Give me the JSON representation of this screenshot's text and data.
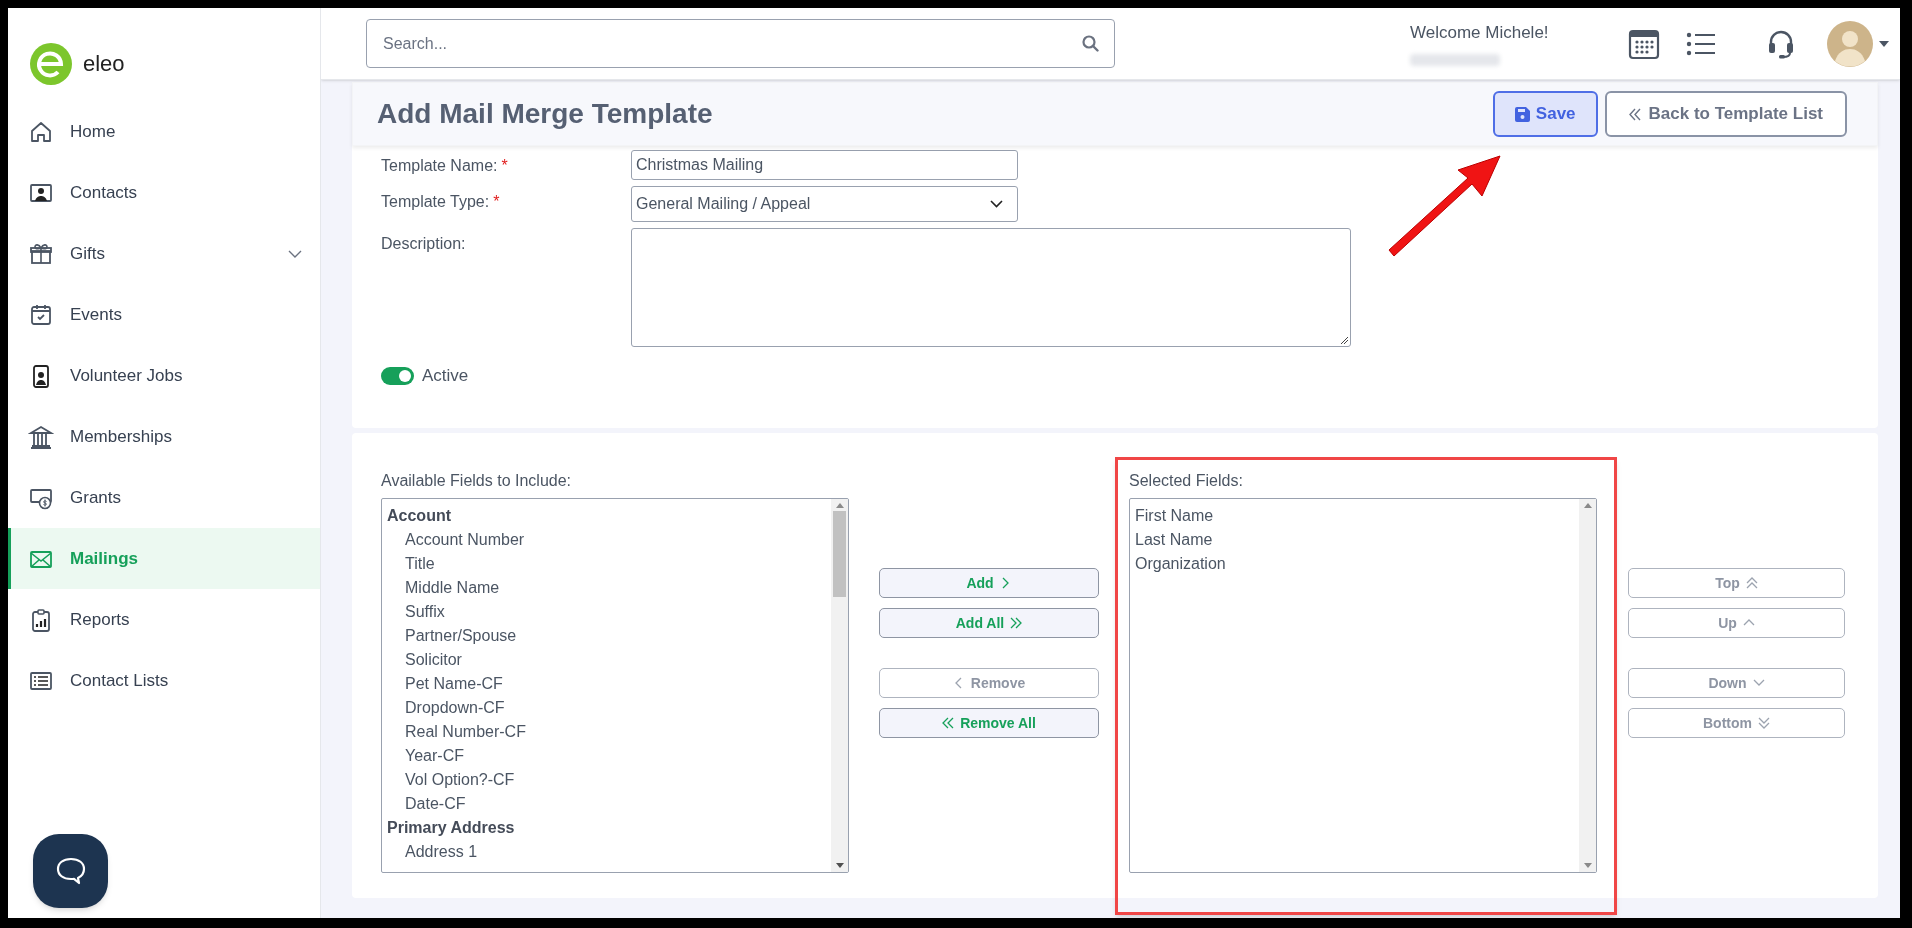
{
  "brand": {
    "name": "eleo"
  },
  "sidebar": {
    "items": [
      {
        "label": "Home",
        "selected": false,
        "kind": "link"
      },
      {
        "label": "Contacts",
        "selected": false,
        "kind": "link"
      },
      {
        "label": "Gifts",
        "selected": false,
        "kind": "menu"
      },
      {
        "label": "Events",
        "selected": false,
        "kind": "link"
      },
      {
        "label": "Volunteer Jobs",
        "selected": false,
        "kind": "link"
      },
      {
        "label": "Memberships",
        "selected": false,
        "kind": "link"
      },
      {
        "label": "Grants",
        "selected": false,
        "kind": "link"
      },
      {
        "label": "Mailings",
        "selected": true,
        "kind": "link"
      },
      {
        "label": "Reports",
        "selected": false,
        "kind": "link"
      },
      {
        "label": "Contact Lists",
        "selected": false,
        "kind": "link"
      }
    ]
  },
  "header": {
    "search": {
      "placeholder": "Search..."
    },
    "welcome": "Welcome Michele!"
  },
  "page": {
    "title": "Add Mail Merge Template",
    "buttons": [
      {
        "label": "Save",
        "kind": "primary"
      },
      {
        "label": "Back to Template List",
        "kind": "back"
      }
    ]
  },
  "form": {
    "fields": [
      {
        "label": "Template Name:",
        "marker": "*",
        "kind": "text",
        "value": "Christmas Mailing"
      },
      {
        "label": "Template Type:",
        "marker": "*",
        "kind": "select",
        "value": "General Mailing / Appeal"
      },
      {
        "label": "Description:",
        "kind": "textarea"
      }
    ],
    "active": {
      "label": "Active",
      "on": true
    }
  },
  "fields_picker": {
    "available": {
      "label": "Available Fields to Include:",
      "items": [
        {
          "text": "Account",
          "kind": "group"
        },
        {
          "text": "Account Number",
          "kind": "field"
        },
        {
          "text": "Title",
          "kind": "field"
        },
        {
          "text": "Middle Name",
          "kind": "field"
        },
        {
          "text": "Suffix",
          "kind": "field"
        },
        {
          "text": "Partner/Spouse",
          "kind": "field"
        },
        {
          "text": "Solicitor",
          "kind": "field"
        },
        {
          "text": "Pet Name-CF",
          "kind": "field"
        },
        {
          "text": "Dropdown-CF",
          "kind": "field"
        },
        {
          "text": "Real Number-CF",
          "kind": "field"
        },
        {
          "text": "Year-CF",
          "kind": "field"
        },
        {
          "text": "Vol Option?-CF",
          "kind": "field"
        },
        {
          "text": "Date-CF",
          "kind": "field"
        },
        {
          "text": "Primary Address",
          "kind": "group"
        },
        {
          "text": "Address 1",
          "kind": "field"
        }
      ]
    },
    "transfer_buttons": [
      {
        "label": "Add",
        "disabled": false
      },
      {
        "label": "Add All",
        "disabled": false
      },
      {
        "label": "Remove",
        "disabled": true
      },
      {
        "label": "Remove All",
        "disabled": false
      }
    ],
    "selected": {
      "label": "Selected Fields:",
      "items": [
        {
          "text": "First Name"
        },
        {
          "text": "Last Name"
        },
        {
          "text": "Organization"
        }
      ]
    },
    "order_buttons": [
      {
        "label": "Top",
        "disabled": true
      },
      {
        "label": "Up",
        "disabled": true
      },
      {
        "label": "Down",
        "disabled": true
      },
      {
        "label": "Bottom",
        "disabled": true
      }
    ]
  }
}
